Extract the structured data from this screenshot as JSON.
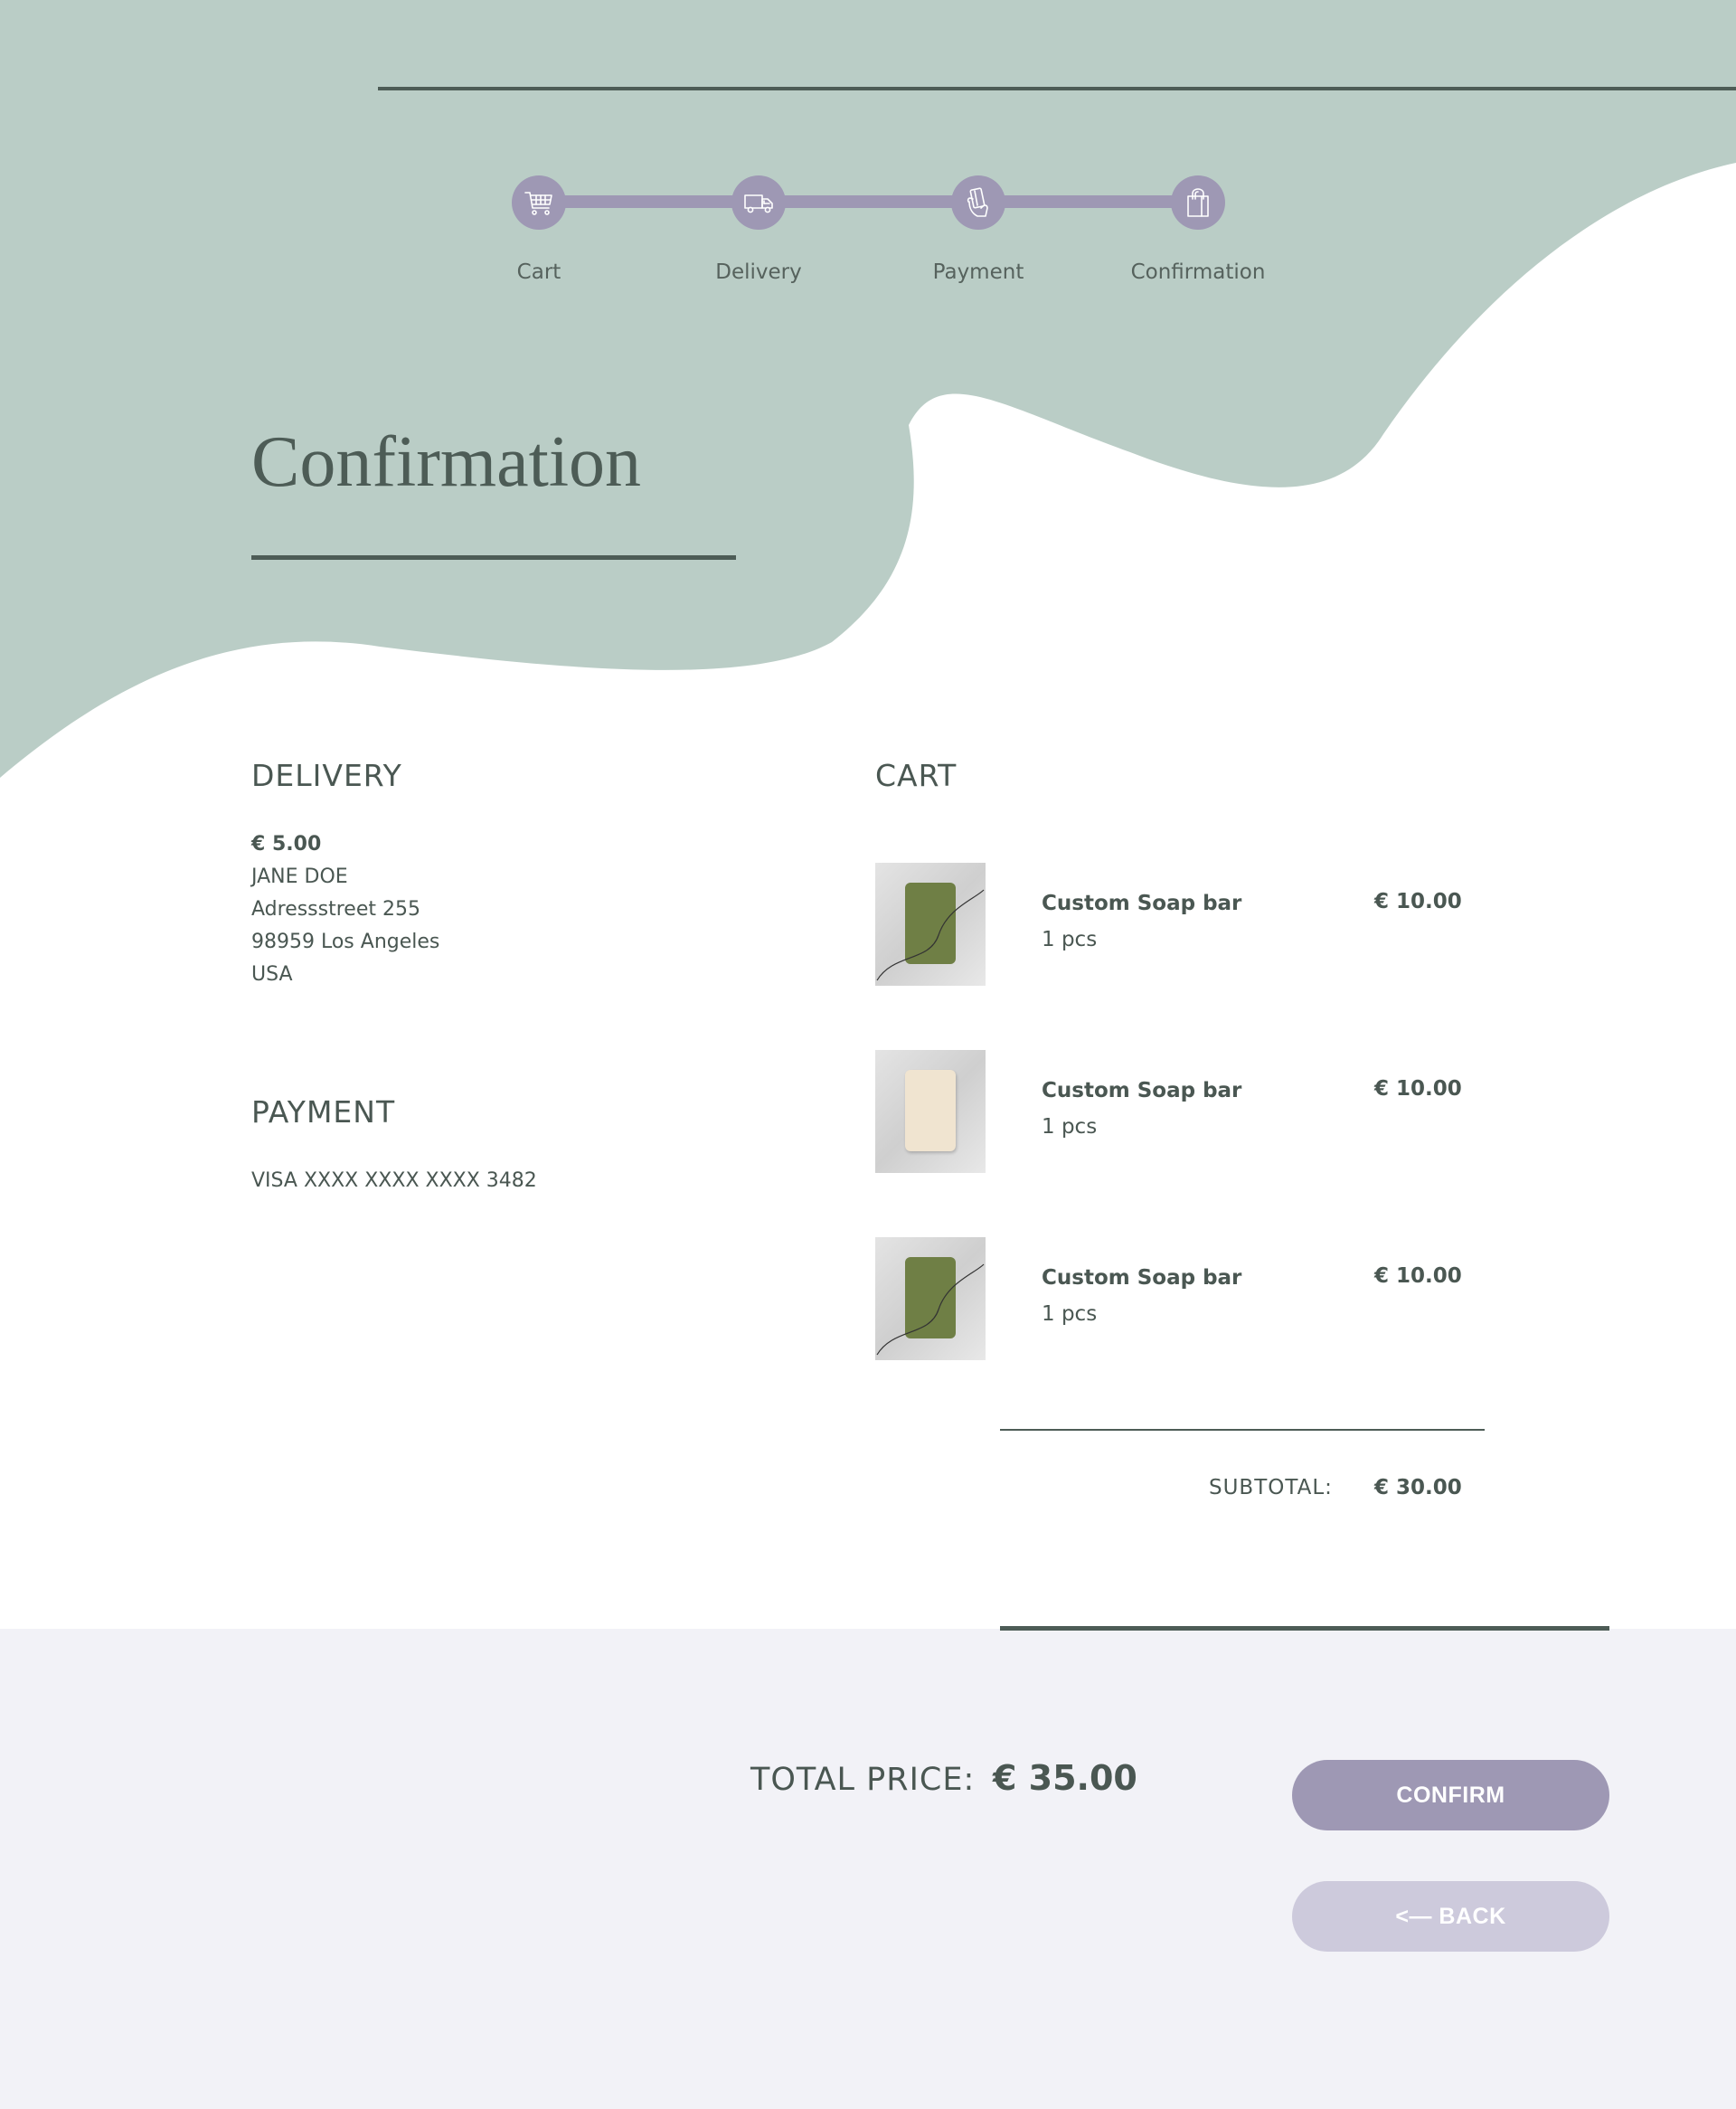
{
  "colors": {
    "sage": "#bacdc6",
    "accent": "#9e98b4",
    "accent_light": "#cdcadc",
    "text": "#4a5752",
    "footer_bg": "#f2f2f7"
  },
  "stepper": {
    "steps": [
      {
        "label": "Cart",
        "icon": "cart-icon"
      },
      {
        "label": "Delivery",
        "icon": "truck-icon"
      },
      {
        "label": "Payment",
        "icon": "card-hand-icon"
      },
      {
        "label": "Confirmation",
        "icon": "shopping-bag-icon"
      }
    ]
  },
  "page": {
    "title": "Confirmation"
  },
  "delivery": {
    "heading": "DELIVERY",
    "price": "€ 5.00",
    "name": "JANE DOE",
    "street": "Adressstreet 255",
    "city": "98959 Los Angeles",
    "country": "USA"
  },
  "payment": {
    "heading": "PAYMENT",
    "card": "VISA XXXX XXXX XXXX 3482"
  },
  "cart": {
    "heading": "CART",
    "items": [
      {
        "name": "Custom Soap bar",
        "qty": "1 pcs",
        "price": "€ 10.00",
        "soap_color": "#6f7f45"
      },
      {
        "name": "Custom Soap bar",
        "qty": "1 pcs",
        "price": "€ 10.00",
        "soap_color": "#f0e4d0"
      },
      {
        "name": "Custom Soap bar",
        "qty": "1 pcs",
        "price": "€ 10.00",
        "soap_color": "#6f7f45"
      }
    ],
    "subtotal_label": "SUBTOTAL:",
    "subtotal_value": "€ 30.00"
  },
  "footer": {
    "total_label": "TOTAL PRICE:",
    "total_value": "€ 35.00",
    "confirm_label": "CONFIRM",
    "back_label": "<— BACK"
  }
}
